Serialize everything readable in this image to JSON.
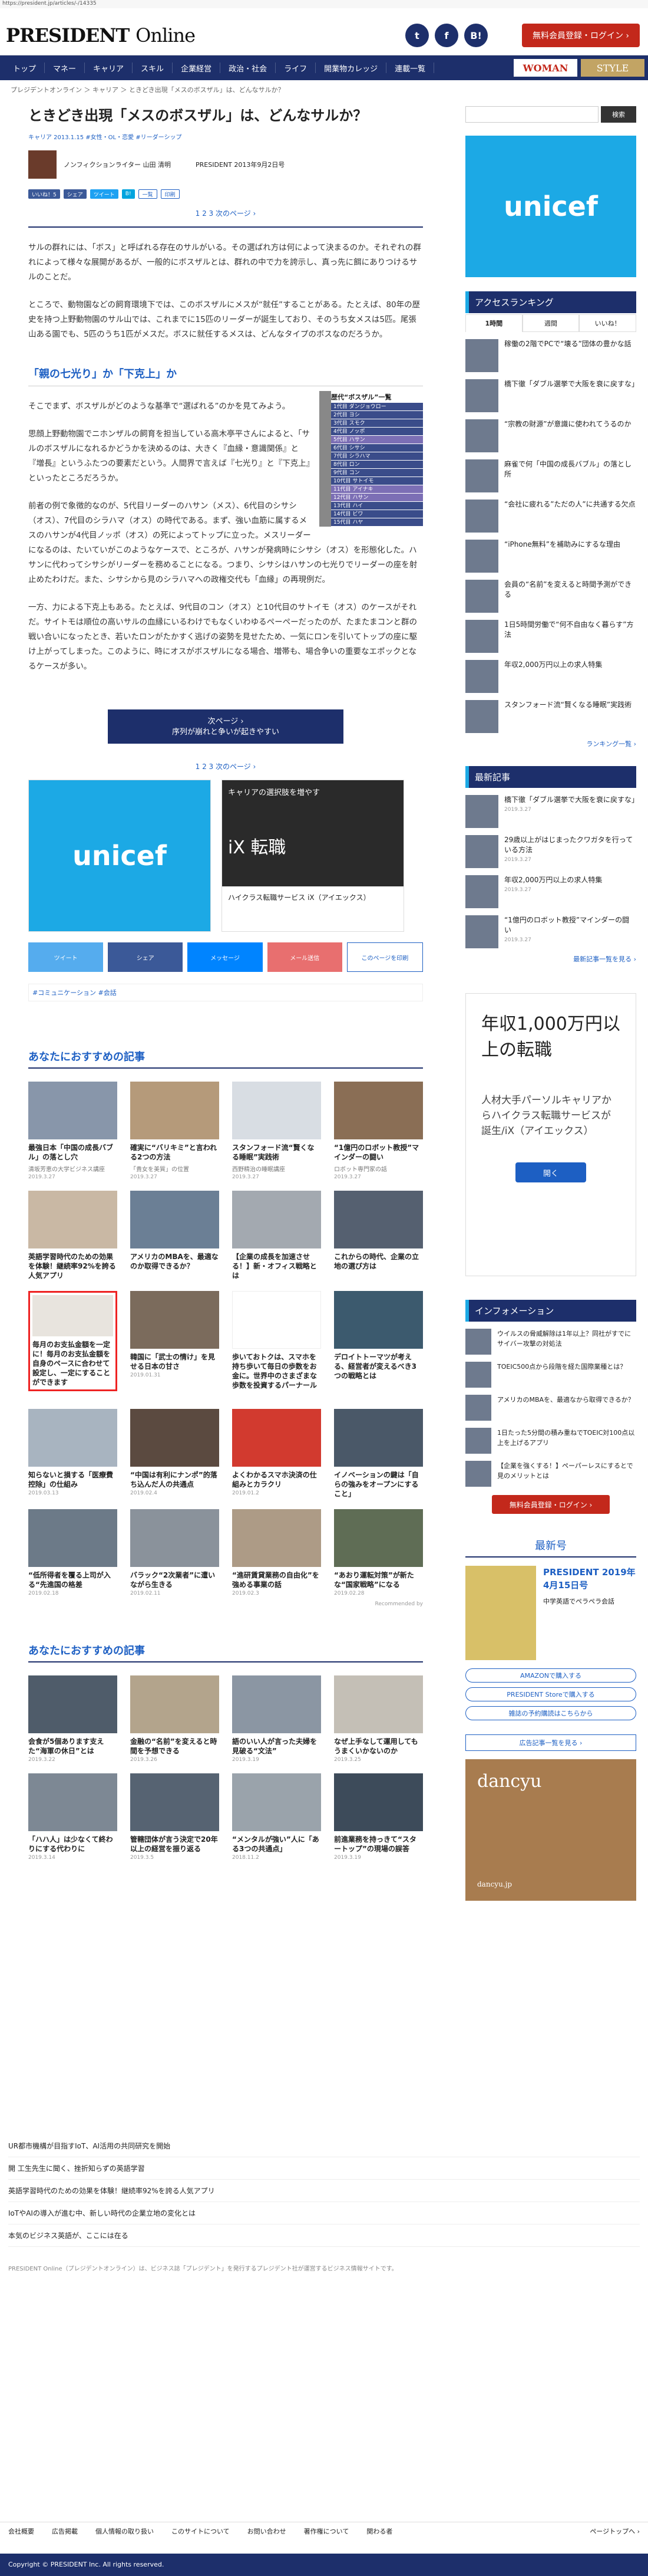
{
  "url": "https://president.jp/articles/-/14335",
  "header": {
    "logo_main": "PRESIDENT",
    "logo_sub": "Online",
    "social": [
      "t",
      "f",
      "B!"
    ],
    "login": "無料会員登録・ログイン ›"
  },
  "nav": {
    "items": [
      "トップ",
      "マネー",
      "キャリア",
      "スキル",
      "企業経営",
      "政治・社会",
      "ライフ",
      "開業物カレッジ",
      "連載一覧"
    ],
    "woman": "WOMAN",
    "style": "STYLE"
  },
  "breadcrumb": "プレジデントオンライン ＞ キャリア ＞ ときどき出現「メスのボスザル」は、どんなサルか？",
  "article": {
    "title": "ときどき出現「メスのボスザル」は、どんなサルか？",
    "meta": "キャリア 2013.1.15",
    "tags": "#女性・OL・恋愛 #リーダーシップ",
    "author_name": "ノンフィクションライター 山田 清明",
    "issue": "PRESIDENT 2013年9月2日号",
    "share": [
      "いいね！5",
      "シェア",
      "ツイート",
      "B!",
      "一覧",
      "印刷"
    ],
    "pager": "1 2 3 次のページ ›",
    "p1": "サルの群れには、「ボス」と呼ばれる存在のサルがいる。その選ばれ方は何によって決まるのか。それぞれの群れによって様々な展開があるが、一般的にボスザルとは、群れの中で力を誇示し、真っ先に餌にありつけるサルのことだ。",
    "p2": "ところで、動物園などの飼育環境下では、このボスザルにメスが“就任”することがある。たとえば、80年の歴史を持つ上野動物園のサル山では、これまでに15匹のリーダーが誕生しており、そのうち女メスは5匹。尾張山ある園でも、5匹のうち1匹がメスだ。ボスに就任するメスは、どんなタイプのボスなのだろうか。",
    "subhead": "「親の七光り」か「下克上」か",
    "p3": "そこでまず、ボスザルがどのような基準で“選ばれる”のかを見てみよう。",
    "p4": "思顔上野動物園でニホンザルの飼育を担当している高木亭平さんによると、「サルのボスザルになれるかどうかを決めるのは、大きく『血縁・意識関係』と『増長』というふたつの要素だという。人間界で言えば『七光り』と『下克上』といったところだろうか。",
    "p5": "前者の例で象徴的なのが、5代目リーダーのハサン（メス）、6代目のシサシ（オス）、7代目のシラハマ（オス）の時代である。まず、強い血筋に属するメスのハサンが4代目ノッポ（オス）の死によってトップに立った。メスリーダーになるのは、たいていがこのようなケースで、ところが、ハサンが発病時にシサシ（オス）を形態化した。ハサンに代わってシサシがリーダーを務めることになる。つまり、シサシはハサンの七光りでリーダーの座を射止めたわけだ。また、シサシから見のシラハマへの政権交代も「血縁」の再現例だ。",
    "p6": "一方、力による下克上もある。たとえば、9代目のコン（オス）と10代目のサトイモ（オス）のケースがそれだ。サイトモは順位の高いサルの血縁にいるわけでもなくいわゆるペーペーだったのが、たまたまコンと群の戦い合いになったとき、若いたロンがたかすく逃げの姿勢を見せたため、一気にロンを引いてトップの座に駆け上がってしまった。このように、時にオスがボスザルになる場合、増帯も、場合争いの重要なエポックとなるケースが多い。",
    "next_btn_line1": "次ページ ›",
    "next_btn_line2": "序列が崩れと争いが起きやすい",
    "pager2": "1 2 3 次のページ ›"
  },
  "ranking_table": {
    "title": "歴代“ボスザル”一覧",
    "rows": [
      "1代目 ダンジョウロー",
      "2代目 ヨシ",
      "3代目 スモク",
      "4代目 ノッポ",
      "5代目 ハサン",
      "6代目 シサシ",
      "7代目 シラハマ",
      "8代目 ロン",
      "9代目 コン",
      "10代目 サトイモ",
      "11代目 アイナキ",
      "12代目 ハサン",
      "13代目 ハイ",
      "14代目 ビワ",
      "15代目 ハヤ"
    ]
  },
  "ads": {
    "unicef": "unicef",
    "ad2_title": "キャリアの選択肢を増やす",
    "ad2_sub": "ハイクラス転職サービス iX（アイエックス）",
    "ad2_logo": "iX 転職"
  },
  "share_row": [
    "ツイート",
    "シェア",
    "メッセージ",
    "メール送信",
    "このページを印刷"
  ],
  "hashtags": "#コミュニケーション #会話",
  "recs1": {
    "title": "あなたにおすすめの記事",
    "items": [
      {
        "t": "最強日本「中国の成長バブル」の落とし穴",
        "s": "清坂芳恵の大学ビジネス講座",
        "d": "2019.3.27"
      },
      {
        "t": "確実に“バリキミ”と言われる2つの方法",
        "s": "「貴女を美質」の位置",
        "d": "2019.3.27"
      },
      {
        "t": "スタンフォード流“賢くなる睡眠”実践術",
        "s": "西野精治の睡眠講座",
        "d": "2019.3.27"
      },
      {
        "t": "“1億円のロボット教授”マインダーの闘い",
        "s": "ロボット専門家の話",
        "d": "2019.3.27"
      },
      {
        "t": "英語学習時代のための効果を体験！継続率92%を誇る人気アプリ",
        "s": "",
        "d": ""
      },
      {
        "t": "アメリカのMBAを、最適なのか取得できるか？",
        "s": "",
        "d": ""
      },
      {
        "t": "【企業の成長を加速させる！】新・オフィス戦略とは",
        "s": "",
        "d": ""
      },
      {
        "t": "これからの時代、企業の立地の選び方は",
        "s": "",
        "d": ""
      },
      {
        "t": "毎月のお支払金額を一定に！毎月のお支払金額を自身のペースに合わせて設定し、一定にすることができます",
        "s": "",
        "d": ""
      },
      {
        "t": "韓国に「武士の情け」を見せる日本の甘さ",
        "s": "",
        "d": "2019.01.31"
      },
      {
        "t": "歩いておトクは、スマホを持ち歩いて毎日の歩数をお金に。世界中のさまざまな歩数を投資するパーナール",
        "s": "",
        "d": ""
      },
      {
        "t": "デロイトトーマツが考える、経営者が変えるべき3つの戦略とは",
        "s": "",
        "d": ""
      }
    ]
  },
  "recs2": {
    "items": [
      {
        "t": "知らないと損する「医療費控除」の仕組み",
        "d": "2019.03.13"
      },
      {
        "t": "“中国は有利にナンポ”的落ち込んだ人の共通点",
        "d": "2019.02.4"
      },
      {
        "t": "よくわかるスマホ決済の仕組みとカラクリ",
        "d": "2019.01.2"
      },
      {
        "t": "イノベーションの鍵は「自らの強みをオープンにすること」",
        "d": ""
      },
      {
        "t": "“低所得者を覆る上司が入る“先進国の格差",
        "d": "2019.02.18"
      },
      {
        "t": "バラック“2次業者”に遭いながら生きる",
        "d": "2019.02.11"
      },
      {
        "t": "“進研賃貸業務の自由化”を強める事業の話",
        "d": "2019.02.3"
      },
      {
        "t": "“あおり運転対策”が新たな“国家戦略”になる",
        "d": "2019.02.28"
      }
    ],
    "recommended_by": "Recommended by"
  },
  "recs3": {
    "title": "あなたにおすすめの記事",
    "items": [
      {
        "t": "会食が5個あります支えた“海軍の休日”とは",
        "d": "2019.3.22"
      },
      {
        "t": "金融の“名前”を変えると時間を予想できる",
        "d": "2019.3.26"
      },
      {
        "t": "語のいい人が言った夫婦を見破る“文法”",
        "d": "2019.3.19"
      },
      {
        "t": "なぜ上手なして運用してもうまくいかないのか",
        "d": "2019.3.25"
      },
      {
        "t": "「ハハ人」は少なくて終わりにする代わりに",
        "d": "2019.3.14"
      },
      {
        "t": "管轄団体が言う決定で20年以上の経営を振り返る",
        "d": "2019.3.5"
      },
      {
        "t": "“メンタルが強い”人に「ある3つの共通点」",
        "d": "2018.11.2"
      },
      {
        "t": "前進業務を持っきて“スタートップ”の現場の誤答",
        "d": "2019.3.19"
      }
    ]
  },
  "sidebar": {
    "search_btn": "検索",
    "ranking_title": "アクセスランキング",
    "tabs": [
      "1時間",
      "週間",
      "いいね！"
    ],
    "ranking": [
      "稼働の2階でPCで“壊る”団体の豊かな話",
      "橋下徹「ダブル選挙で大阪を衰に戻すな」",
      "“宗教の財源”が意識に使われてうるのか",
      "麻雀で何「中国の成長バブル」の落とし所",
      "“会社に疲れる”ただの人”に共通する欠点",
      "“iPhone無料”を補助みにするな理由",
      "会員の“名前”を変えると時間予測ができる",
      "1日5時間労働で“何不自由なく暮らす”方法",
      "年収2,000万円以上の求人特集",
      "スタンフォード流“賢くなる睡眠”実践術"
    ],
    "ranking_more": "ランキング一覧 ›",
    "new_title": "最新記事",
    "news": [
      {
        "t": "橋下徹「ダブル選挙で大阪を衰に戻すな」",
        "d": "2019.3.27"
      },
      {
        "t": "29歳以上がはじまったクワガタを行っている方法",
        "d": "2019.3.27"
      },
      {
        "t": "年収2,000万円以上の求人特集",
        "d": "2019.3.27"
      },
      {
        "t": "“1億円のロボット教授”マインダーの闘い",
        "d": "2019.3.27"
      }
    ],
    "news_more": "最新記事一覧を見る ›",
    "ad_big": "年収1,000万円以上の転職",
    "ad_sub": "人材大手パーソルキャリアからハイクラス転職サービスが誕生/iX（アイエックス）",
    "ad_btn": "開く",
    "info_title": "インフォメーション",
    "info": [
      "ウイルスの脅威解除は1年以上？同社がすでにサイバー攻撃の対処法",
      "TOEIC500点から段階を経た国際業種とは？",
      "アメリカのMBAを、最適なから取得できるか？",
      "1日たった5分間の積み重ねでTOEIC対100点以上を上げるアプリ",
      "【企業を強くする！】ペーパーレスにするとで見のメリットとは"
    ],
    "info_login": "無料会員登録・ログイン ›",
    "latest_title": "最新号",
    "latest_mag": "PRESIDENT 2019年4月15日号",
    "latest_headline": "中学英語でペラペラ会話",
    "buy_btns": [
      "AMAZONで購入する",
      "PRESIDENT Storeで購入する",
      "雑誌の予約購読はこちらから"
    ],
    "ad_list_btn": "広告記事一覧を見る ›",
    "dancyu": "dancyu",
    "dancyu_sub": "dancyu.jp"
  },
  "footer": {
    "links": [
      "UR都市機構が目指すIoT、AI活用の共同研究を開始",
      "開 工生先生に聞く、挫折知らずの英語学習",
      "英語学習時代のための効果を体験！継続率92%を誇る人気アプリ",
      "IoTやAIの導入が進む中、新しい時代の企業立地の変化とは",
      "本気のビジネス英語が、ここには在る"
    ],
    "note": "PRESIDENT Online（プレジデントオンライン）は、ビジネス誌「プレジデント」を発行するプレジデント社が運営するビジネス情報サイトです。",
    "bottom_nav": [
      "会社概要",
      "広告掲載",
      "個人情報の取り扱い",
      "このサイトについて",
      "お問い合わせ",
      "著作権について",
      "関わる者",
      "ページトップへ ›"
    ],
    "copyright": "Copyright © PRESIDENT Inc. All rights reserved."
  }
}
